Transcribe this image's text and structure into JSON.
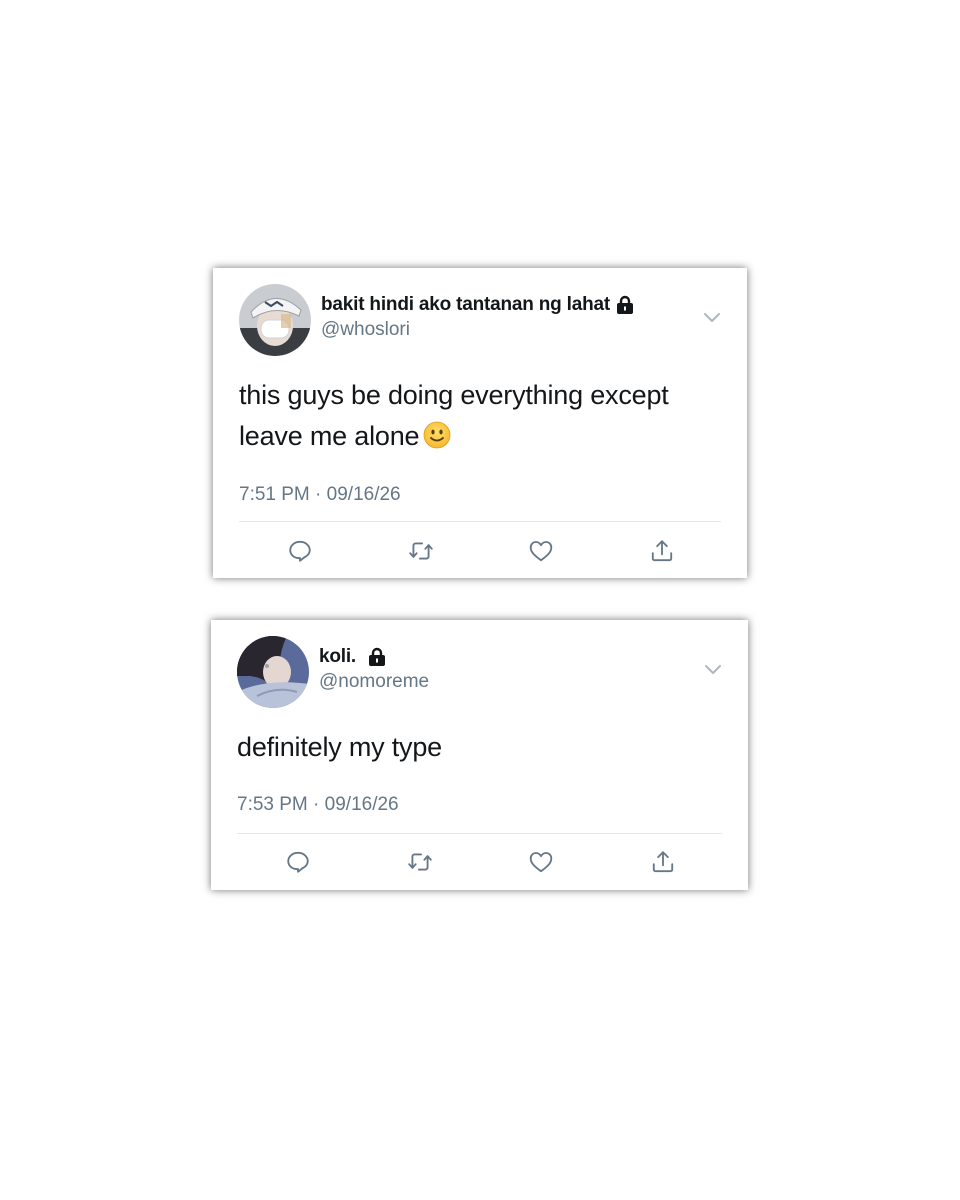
{
  "tweets": [
    {
      "display_name": "bakit hindi ako tantanan ng lahat",
      "handle": "@whoslori",
      "text": "this guys be doing everything except leave me alone",
      "emoji": "slightly-smiling-face",
      "time": "7:51 PM",
      "date": "09/16/26",
      "protected": true
    },
    {
      "display_name": "koli.",
      "handle": "@nomoreme",
      "text": "definitely my type",
      "time": "7:53 PM",
      "date": "09/16/26",
      "protected": true
    }
  ],
  "separator": "·",
  "colors": {
    "text_primary": "#14171a",
    "text_secondary": "#657786",
    "divider": "#e1e8ed",
    "icon": "#657786"
  },
  "icons": {
    "reply": "reply-icon",
    "retweet": "retweet-icon",
    "like": "heart-icon",
    "share": "share-icon",
    "lock": "lock-icon",
    "menu": "chevron-down-icon"
  }
}
